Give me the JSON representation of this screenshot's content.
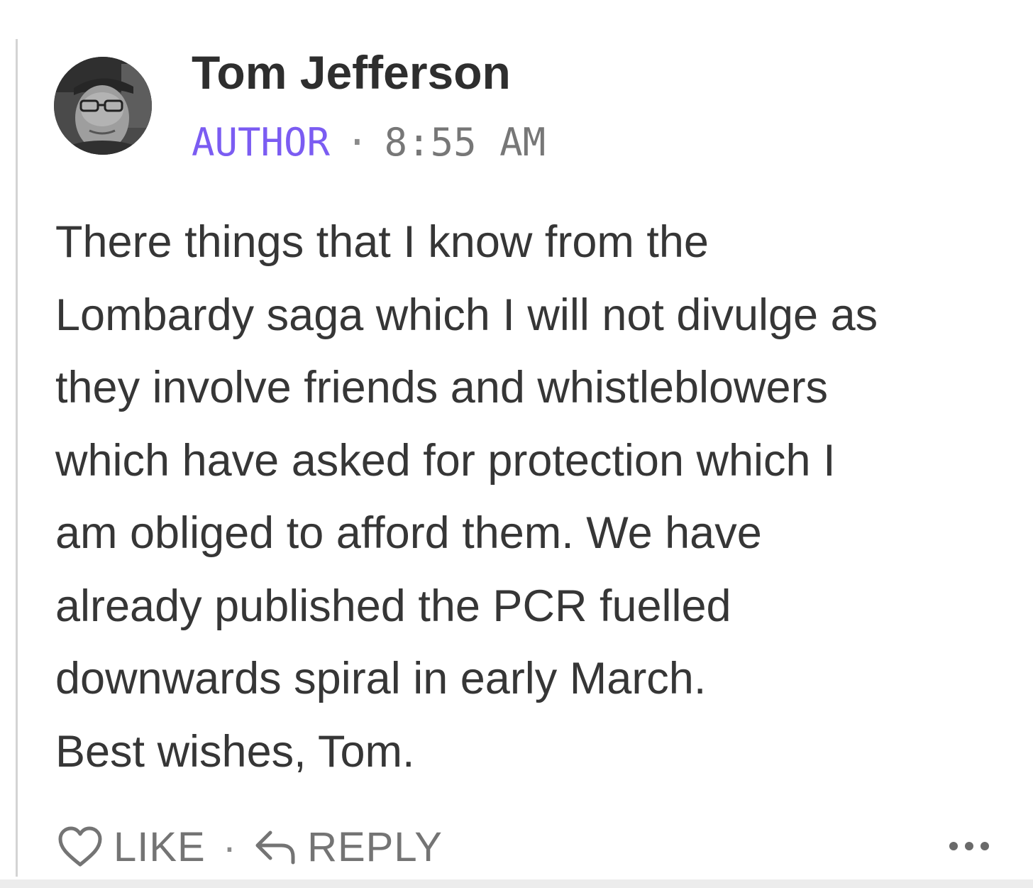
{
  "comment": {
    "author": {
      "name": "Tom Jefferson",
      "avatar_icon": "profile-photo-icon"
    },
    "meta": {
      "badge": "AUTHOR",
      "separator": "·",
      "time": "8:55 AM"
    },
    "body_lines": [
      "There things that I know from the",
      "Lombardy saga which I will not divulge as",
      "they involve friends and whistleblowers",
      "which have asked for protection which I",
      "am obliged to afford them. We have",
      "already published the PCR fuelled",
      "downwards spiral in early March.",
      "Best wishes, Tom."
    ],
    "actions": {
      "like_label": "LIKE",
      "like_icon": "heart-icon",
      "separator": "·",
      "reply_label": "REPLY",
      "reply_icon": "reply-arrow-icon",
      "more_icon": "more-dots-icon"
    }
  },
  "colors": {
    "badge": "#7b5cf2",
    "text": "#363636",
    "meta": "#777777",
    "action": "#747474",
    "thread_line": "#d4d4d4"
  }
}
